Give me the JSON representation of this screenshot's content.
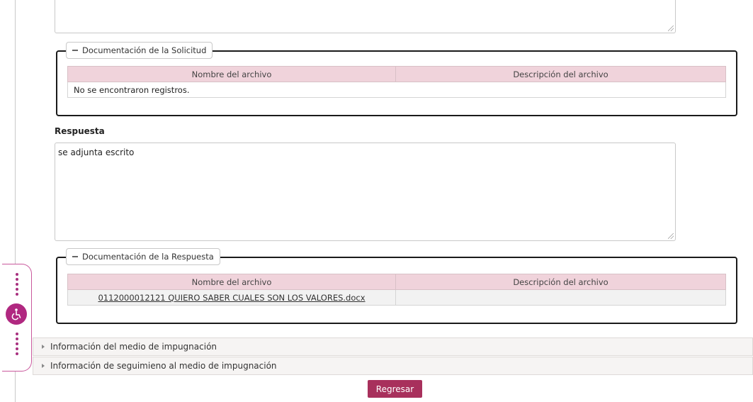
{
  "solicitud_docs": {
    "legend": "Documentación de la Solicitud",
    "columns": [
      "Nombre del archivo",
      "Descripción del archivo"
    ],
    "empty_message": "No se encontraron registros."
  },
  "respuesta": {
    "label": "Respuesta",
    "text": "se adjunta escrito"
  },
  "respuesta_docs": {
    "legend": "Documentación de la Respuesta",
    "columns": [
      "Nombre del archivo",
      "Descripción del archivo"
    ],
    "rows": [
      {
        "file_name": "0112000012121 QUIERO SABER CUALES SON LOS VALORES.docx",
        "description": ""
      }
    ]
  },
  "accordions": [
    {
      "label": "Información del medio de impugnación"
    },
    {
      "label": "Información de seguimieno al medio de impugnación"
    }
  ],
  "buttons": {
    "back": "Regresar"
  },
  "icons": {
    "accessibility": "wheelchair-icon",
    "collapse": "minus-icon",
    "expand": "triangle-right-icon"
  },
  "colors": {
    "accent": "#a8305c",
    "table_header": "#f0d3db",
    "a11y": "#b02880"
  }
}
